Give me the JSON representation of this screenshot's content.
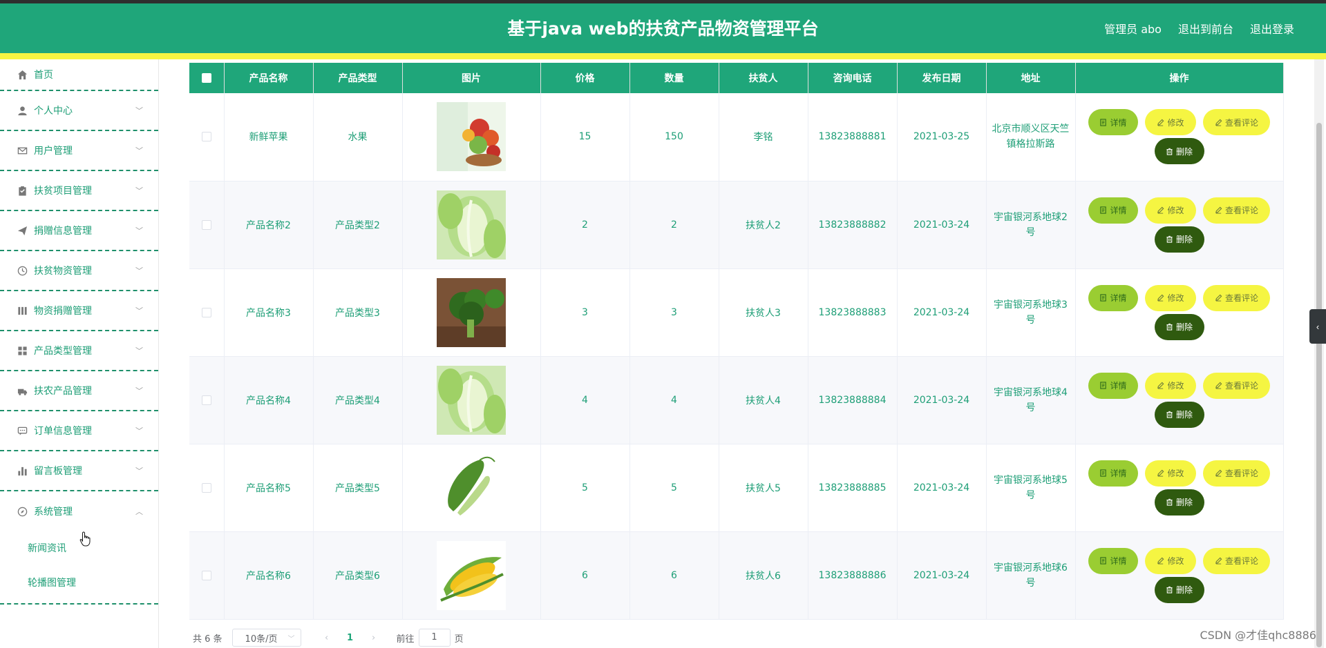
{
  "header": {
    "title": "基于java web的扶贫产品物资管理平台",
    "user_label": "管理员 abo",
    "front_link": "退出到前台",
    "logout_link": "退出登录"
  },
  "sidebar": {
    "items": [
      {
        "label": "首页",
        "icon": "home-icon"
      },
      {
        "label": "个人中心",
        "icon": "user-icon"
      },
      {
        "label": "用户管理",
        "icon": "mail-icon"
      },
      {
        "label": "扶贫项目管理",
        "icon": "clipboard-icon"
      },
      {
        "label": "捐赠信息管理",
        "icon": "send-icon"
      },
      {
        "label": "扶贫物资管理",
        "icon": "clock-icon"
      },
      {
        "label": "物资捐赠管理",
        "icon": "bars-icon"
      },
      {
        "label": "产品类型管理",
        "icon": "grid-icon"
      },
      {
        "label": "扶农产品管理",
        "icon": "truck-icon"
      },
      {
        "label": "订单信息管理",
        "icon": "chat-icon"
      },
      {
        "label": "留言板管理",
        "icon": "chart-icon"
      },
      {
        "label": "系统管理",
        "icon": "compass-icon"
      }
    ],
    "submenu": [
      "新闻资讯",
      "轮播图管理"
    ]
  },
  "table": {
    "columns": [
      "产品名称",
      "产品类型",
      "图片",
      "价格",
      "数量",
      "扶贫人",
      "咨询电话",
      "发布日期",
      "地址",
      "操作"
    ],
    "rows": [
      {
        "name": "新鲜苹果",
        "type": "水果",
        "image": "fruit-basket",
        "price": "15",
        "qty": "150",
        "person": "李铭",
        "phone": "13823888881",
        "date": "2021-03-25",
        "address": "北京市顺义区天竺镇格拉斯路"
      },
      {
        "name": "产品名称2",
        "type": "产品类型2",
        "image": "cabbage",
        "price": "2",
        "qty": "2",
        "person": "扶贫人2",
        "phone": "13823888882",
        "date": "2021-03-24",
        "address": "宇宙银河系地球2号"
      },
      {
        "name": "产品名称3",
        "type": "产品类型3",
        "image": "broccoli",
        "price": "3",
        "qty": "3",
        "person": "扶贫人3",
        "phone": "13823888883",
        "date": "2021-03-24",
        "address": "宇宙银河系地球3号"
      },
      {
        "name": "产品名称4",
        "type": "产品类型4",
        "image": "cabbage",
        "price": "4",
        "qty": "4",
        "person": "扶贫人4",
        "phone": "13823888884",
        "date": "2021-03-24",
        "address": "宇宙银河系地球4号"
      },
      {
        "name": "产品名称5",
        "type": "产品类型5",
        "image": "bitter-melon",
        "price": "5",
        "qty": "5",
        "person": "扶贫人5",
        "phone": "13823888885",
        "date": "2021-03-24",
        "address": "宇宙银河系地球5号"
      },
      {
        "name": "产品名称6",
        "type": "产品类型6",
        "image": "corn",
        "price": "6",
        "qty": "6",
        "person": "扶贫人6",
        "phone": "13823888886",
        "date": "2021-03-24",
        "address": "宇宙银河系地球6号"
      }
    ],
    "actions": {
      "detail": "详情",
      "edit": "修改",
      "comment": "查看评论",
      "delete": "删除"
    }
  },
  "pagination": {
    "total": "共 6 条",
    "page_size": "10条/页",
    "current_page": "1",
    "goto_label": "前往",
    "goto_value": "1",
    "page_suffix": "页"
  },
  "watermark": "CSDN @才佳qhc8886",
  "colors": {
    "primary": "#1fa67a",
    "stripe": "#f5f542",
    "detail": "#9acd32",
    "delete": "#2f5a0f"
  }
}
